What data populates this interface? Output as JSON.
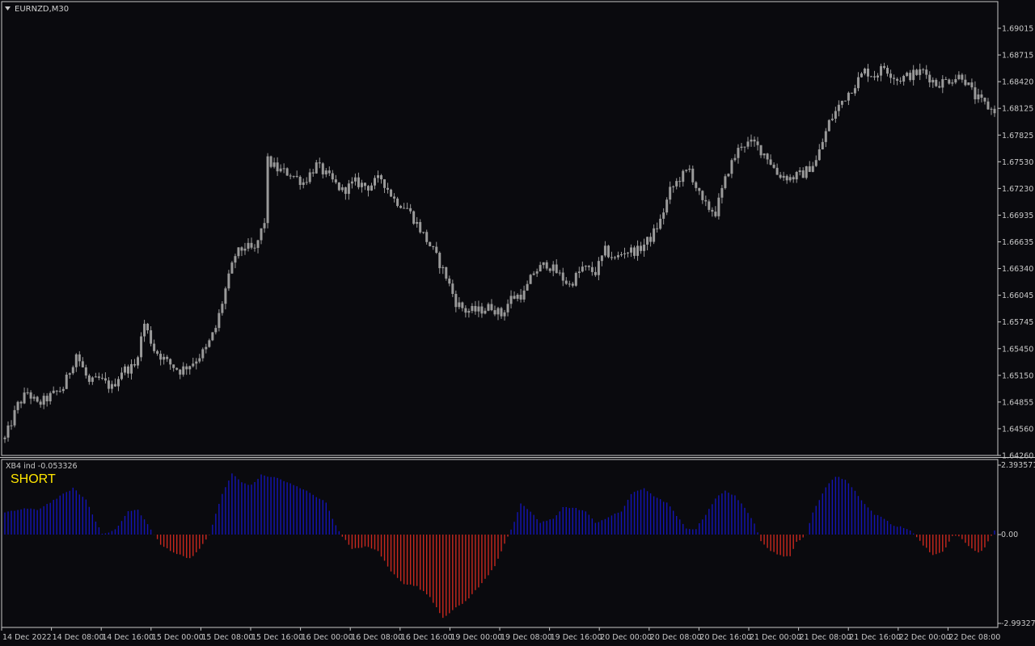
{
  "window": {
    "symbol_label": "EURNZD,M30"
  },
  "indicator": {
    "label": "XB4 ind -0.053326",
    "signal": "SHORT",
    "scale_top": "2.393571",
    "scale_zero": "0.00",
    "scale_bottom": "-2.993279"
  },
  "colors": {
    "background": "#0a0a0e",
    "frame": "#c8c8c8",
    "candle": "#9a9a9a",
    "histogram_positive": "#1414b4",
    "histogram_negative": "#c8281e",
    "signal_text": "#ffe600"
  },
  "chart_data": [
    {
      "type": "candlestick",
      "title": "EURNZD,M30",
      "y_ticks": [
        "1.69015",
        "1.68715",
        "1.68420",
        "1.68125",
        "1.67825",
        "1.67530",
        "1.67230",
        "1.66935",
        "1.66635",
        "1.66340",
        "1.66045",
        "1.65745",
        "1.65450",
        "1.65150",
        "1.64855",
        "1.64560",
        "1.64260"
      ],
      "ylim": [
        1.6426,
        1.6925
      ],
      "x_ticks": [
        "14 Dec 2022",
        "14 Dec 08:00",
        "14 Dec 16:00",
        "15 Dec 00:00",
        "15 Dec 08:00",
        "15 Dec 16:00",
        "16 Dec 00:00",
        "16 Dec 08:00",
        "16 Dec 16:00",
        "19 Dec 00:00",
        "19 Dec 08:00",
        "19 Dec 16:00",
        "20 Dec 00:00",
        "20 Dec 08:00",
        "20 Dec 16:00",
        "21 Dec 00:00",
        "21 Dec 08:00",
        "21 Dec 16:00",
        "22 Dec 00:00",
        "22 Dec 08:00"
      ],
      "close_path_anchors": [
        [
          0,
          1.6445
        ],
        [
          4,
          1.6485
        ],
        [
          7,
          1.65
        ],
        [
          10,
          1.6485
        ],
        [
          14,
          1.6495
        ],
        [
          18,
          1.6505
        ],
        [
          22,
          1.6545
        ],
        [
          26,
          1.651
        ],
        [
          29,
          1.6515
        ],
        [
          33,
          1.6505
        ],
        [
          36,
          1.6525
        ],
        [
          40,
          1.653
        ],
        [
          43,
          1.658
        ],
        [
          46,
          1.655
        ],
        [
          50,
          1.6535
        ],
        [
          54,
          1.6525
        ],
        [
          58,
          1.6535
        ],
        [
          62,
          1.655
        ],
        [
          65,
          1.6575
        ],
        [
          68,
          1.662
        ],
        [
          71,
          1.666
        ],
        [
          74,
          1.667
        ],
        [
          77,
          1.6665
        ],
        [
          80,
          1.67
        ],
        [
          81,
          1.677
        ],
        [
          84,
          1.676
        ],
        [
          88,
          1.6755
        ],
        [
          92,
          1.6745
        ],
        [
          96,
          1.6765
        ],
        [
          100,
          1.675
        ],
        [
          104,
          1.6735
        ],
        [
          108,
          1.6745
        ],
        [
          112,
          1.674
        ],
        [
          116,
          1.675
        ],
        [
          120,
          1.6725
        ],
        [
          124,
          1.6715
        ],
        [
          128,
          1.669
        ],
        [
          132,
          1.6665
        ],
        [
          136,
          1.6635
        ],
        [
          139,
          1.6605
        ],
        [
          142,
          1.6595
        ],
        [
          146,
          1.6595
        ],
        [
          150,
          1.66
        ],
        [
          153,
          1.659
        ],
        [
          156,
          1.661
        ],
        [
          160,
          1.6615
        ],
        [
          163,
          1.664
        ],
        [
          167,
          1.665
        ],
        [
          170,
          1.664
        ],
        [
          174,
          1.6625
        ],
        [
          178,
          1.6645
        ],
        [
          182,
          1.664
        ],
        [
          185,
          1.6665
        ],
        [
          188,
          1.6655
        ],
        [
          191,
          1.6665
        ],
        [
          195,
          1.6665
        ],
        [
          199,
          1.668
        ],
        [
          202,
          1.67
        ],
        [
          205,
          1.6735
        ],
        [
          208,
          1.675
        ],
        [
          211,
          1.676
        ],
        [
          215,
          1.672
        ],
        [
          219,
          1.671
        ],
        [
          223,
          1.676
        ],
        [
          227,
          1.679
        ],
        [
          231,
          1.679
        ],
        [
          235,
          1.6775
        ],
        [
          238,
          1.6755
        ],
        [
          242,
          1.675
        ],
        [
          246,
          1.6755
        ],
        [
          250,
          1.677
        ],
        [
          254,
          1.6815
        ],
        [
          258,
          1.684
        ],
        [
          261,
          1.6855
        ],
        [
          265,
          1.6875
        ],
        [
          268,
          1.687
        ],
        [
          271,
          1.688
        ],
        [
          275,
          1.6865
        ],
        [
          279,
          1.687
        ],
        [
          283,
          1.6875
        ],
        [
          287,
          1.686
        ],
        [
          291,
          1.6865
        ],
        [
          295,
          1.687
        ],
        [
          299,
          1.6845
        ],
        [
          304,
          1.683
        ]
      ]
    },
    {
      "type": "histogram",
      "title": "XB4 ind -0.053326",
      "ylim": [
        -2.993279,
        2.393571
      ],
      "y_ticks": [
        "2.393571",
        "0.00",
        "-2.993279"
      ],
      "zero_line": 0.0,
      "value_anchors": [
        [
          0,
          0.75
        ],
        [
          6,
          0.9
        ],
        [
          10,
          0.85
        ],
        [
          16,
          1.25
        ],
        [
          21,
          1.6
        ],
        [
          25,
          1.2
        ],
        [
          28,
          0.45
        ],
        [
          30,
          0.05
        ],
        [
          33,
          0.1
        ],
        [
          35,
          0.3
        ],
        [
          38,
          0.8
        ],
        [
          41,
          0.85
        ],
        [
          44,
          0.35
        ],
        [
          46,
          0.0
        ],
        [
          48,
          -0.35
        ],
        [
          53,
          -0.65
        ],
        [
          57,
          -0.8
        ],
        [
          60,
          -0.5
        ],
        [
          63,
          0.0
        ],
        [
          67,
          1.4
        ],
        [
          70,
          2.1
        ],
        [
          73,
          1.8
        ],
        [
          76,
          1.7
        ],
        [
          79,
          2.05
        ],
        [
          84,
          1.95
        ],
        [
          89,
          1.7
        ],
        [
          94,
          1.45
        ],
        [
          99,
          1.1
        ],
        [
          102,
          0.3
        ],
        [
          104,
          -0.05
        ],
        [
          107,
          -0.5
        ],
        [
          111,
          -0.4
        ],
        [
          115,
          -0.55
        ],
        [
          119,
          -1.25
        ],
        [
          123,
          -1.65
        ],
        [
          127,
          -1.75
        ],
        [
          131,
          -2.1
        ],
        [
          135,
          -2.8
        ],
        [
          138,
          -2.55
        ],
        [
          142,
          -2.25
        ],
        [
          147,
          -1.65
        ],
        [
          151,
          -1.05
        ],
        [
          154,
          -0.3
        ],
        [
          156,
          0.15
        ],
        [
          159,
          1.05
        ],
        [
          162,
          0.8
        ],
        [
          165,
          0.4
        ],
        [
          169,
          0.55
        ],
        [
          172,
          0.95
        ],
        [
          176,
          0.9
        ],
        [
          179,
          0.8
        ],
        [
          182,
          0.4
        ],
        [
          186,
          0.6
        ],
        [
          190,
          0.8
        ],
        [
          193,
          1.4
        ],
        [
          197,
          1.6
        ],
        [
          201,
          1.25
        ],
        [
          204,
          1.1
        ],
        [
          207,
          0.65
        ],
        [
          210,
          0.2
        ],
        [
          213,
          0.2
        ],
        [
          216,
          0.7
        ],
        [
          219,
          1.25
        ],
        [
          222,
          1.5
        ],
        [
          225,
          1.35
        ],
        [
          228,
          0.9
        ],
        [
          231,
          0.4
        ],
        [
          233,
          -0.2
        ],
        [
          236,
          -0.55
        ],
        [
          239,
          -0.7
        ],
        [
          242,
          -0.75
        ],
        [
          244,
          -0.25
        ],
        [
          247,
          0.0
        ],
        [
          249,
          0.75
        ],
        [
          253,
          1.65
        ],
        [
          256,
          2.0
        ],
        [
          259,
          1.9
        ],
        [
          262,
          1.5
        ],
        [
          265,
          1.05
        ],
        [
          268,
          0.7
        ],
        [
          271,
          0.55
        ],
        [
          274,
          0.3
        ],
        [
          277,
          0.25
        ],
        [
          280,
          0.05
        ],
        [
          283,
          -0.35
        ],
        [
          286,
          -0.7
        ],
        [
          289,
          -0.6
        ],
        [
          292,
          -0.05
        ],
        [
          294,
          -0.05
        ],
        [
          297,
          -0.4
        ],
        [
          300,
          -0.6
        ],
        [
          302,
          -0.45
        ],
        [
          304,
          -0.05
        ],
        [
          305,
          0.15
        ]
      ]
    }
  ]
}
